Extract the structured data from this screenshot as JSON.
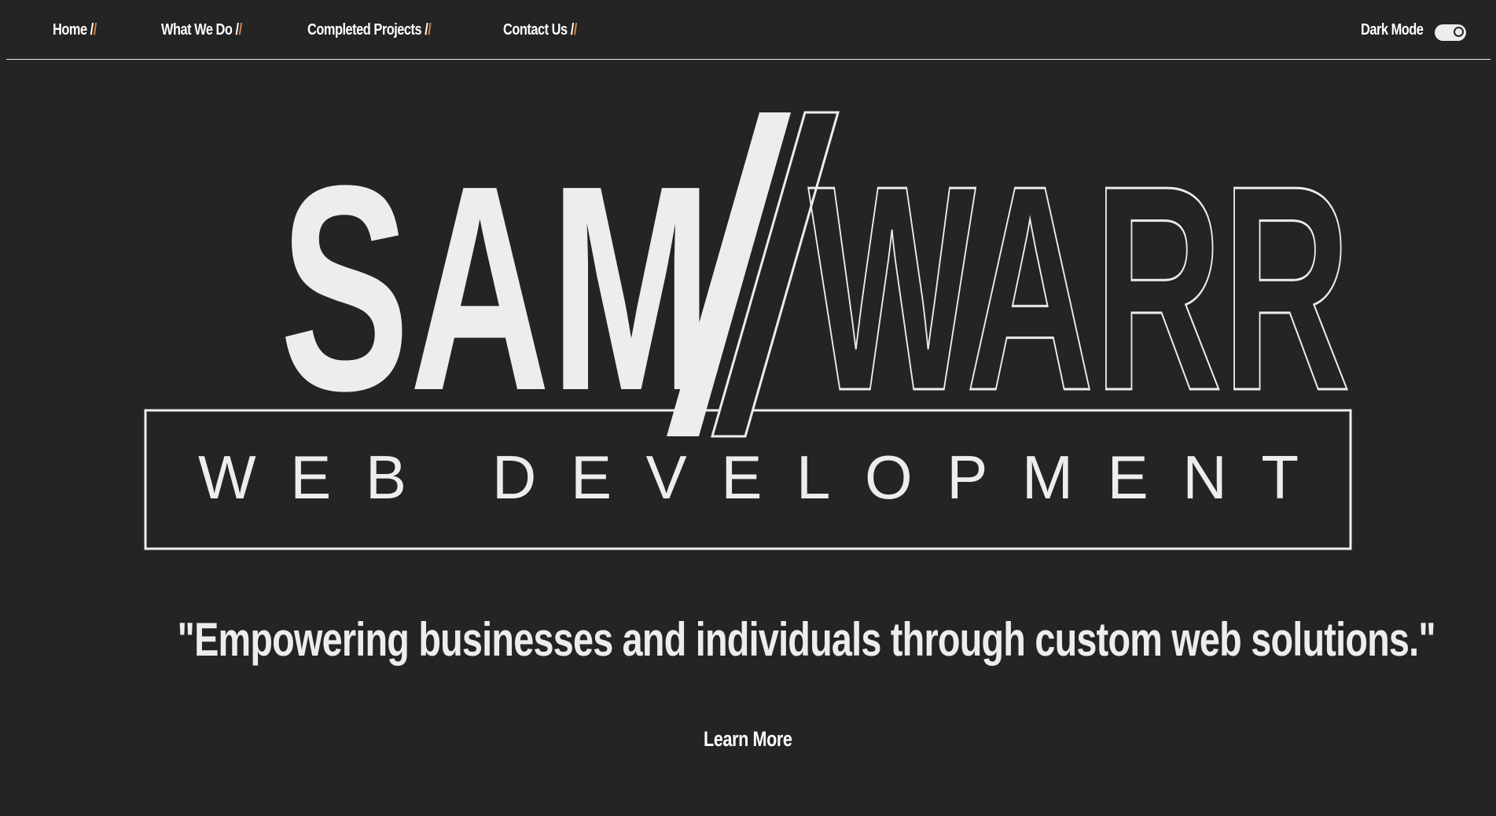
{
  "nav": {
    "items": [
      {
        "label": "Home /",
        "accent": "/"
      },
      {
        "label": "What We Do /",
        "accent": "/"
      },
      {
        "label": "Completed Projects /",
        "accent": "/"
      },
      {
        "label": "Contact Us /",
        "accent": "/"
      }
    ],
    "dark_mode_label": "Dark Mode",
    "dark_mode_on": true
  },
  "logo": {
    "word1": "SAM",
    "word2": "WARR",
    "subtitle": "WEB DEVELOPMENT"
  },
  "hero": {
    "tagline": "\"Empowering businesses and individuals through custom web solutions.\"",
    "cta_label": "Learn More"
  },
  "colors": {
    "background": "#242424",
    "foreground": "#eeedeb",
    "accent": "#e0813c"
  }
}
